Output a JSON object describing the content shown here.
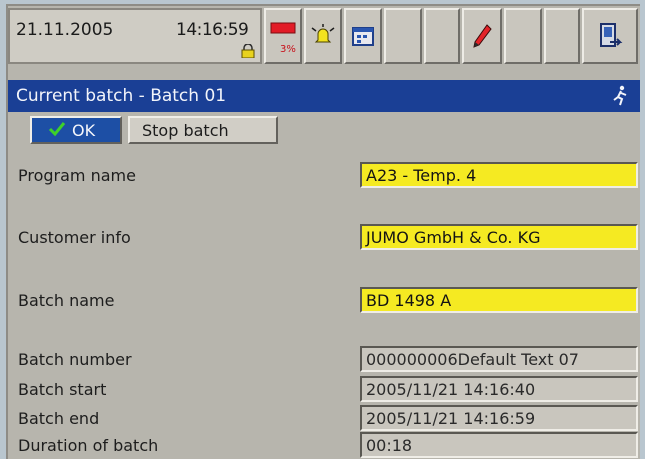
{
  "status": {
    "date": "21.11.2005",
    "time": "14:16:59",
    "memory_percent": "3%"
  },
  "toolbar_icons": [
    "lock-icon",
    "memory-usage-icon",
    "alarm-bell-icon",
    "calendar-icon",
    "empty-slot",
    "pencil-icon",
    "empty-slot",
    "empty-slot",
    "exit-icon"
  ],
  "window": {
    "title": "Current batch - Batch 01",
    "title_icon": "running-figure-icon"
  },
  "actions": {
    "ok_label": "OK",
    "stop_label": "Stop batch"
  },
  "fields": {
    "program_name": {
      "label": "Program name",
      "value": "A23 - Temp. 4"
    },
    "customer_info": {
      "label": "Customer info",
      "value": "JUMO GmbH & Co. KG"
    },
    "batch_name": {
      "label": "Batch name",
      "value": "BD 1498 A"
    },
    "batch_number": {
      "label": "Batch number",
      "value": "000000006Default Text 07"
    },
    "batch_start": {
      "label": "Batch start",
      "value": "2005/11/21 14:16:40"
    },
    "batch_end": {
      "label": "Batch end",
      "value": "2005/11/21 14:16:59"
    },
    "duration": {
      "label": "Duration of batch",
      "value": "00:18"
    }
  },
  "colors": {
    "title_bar": "#1a3f95",
    "edit_field": "#f5ea22",
    "ok_button": "#1d4fa5",
    "panel": "#b7b5ad"
  }
}
